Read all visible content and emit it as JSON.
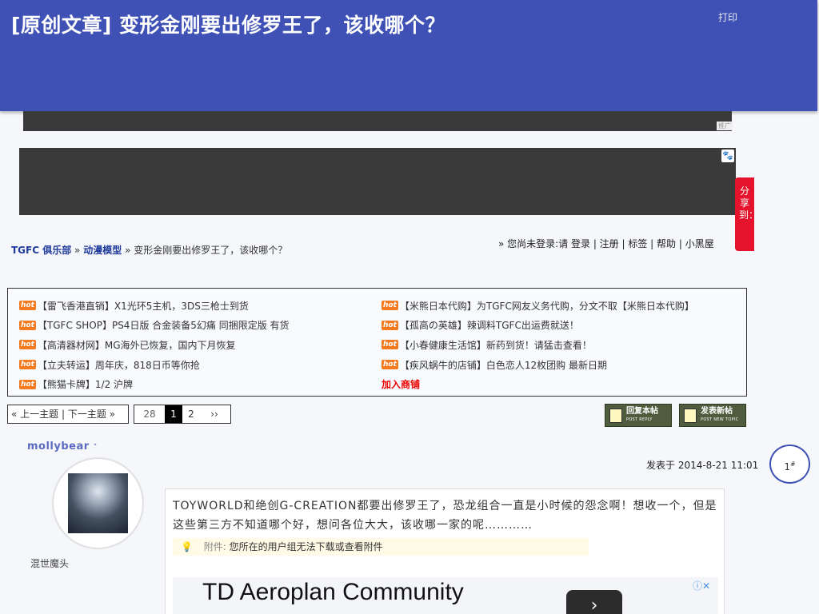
{
  "header": {
    "title": "[原创文章] 变形金刚要出修罗王了，该收哪个？",
    "print_label": "打印"
  },
  "ads": {
    "tag": "推广",
    "share_label": "分享到：",
    "bottom_ad_title": "TD Aeroplan Community",
    "bottom_ad_arrow": "›",
    "bottom_ad_info": "ⓘ✕"
  },
  "breadcrumb": {
    "site": "TGFC 俱乐部",
    "sep": "»",
    "forum": "动漫模型",
    "thread": "变形金刚要出修罗王了，该收哪个？"
  },
  "login_bar": "» 您尚未登录:请 登录 | 注册 | 标签 | 帮助 | 小黑屋",
  "hot_label": "hot",
  "sponsor_links": {
    "left": [
      "【雷飞香港直销】X1光环5主机，3DS三枪士到货",
      "【TGFC SHOP】PS4日版 合金装备5幻痛 同捆限定版 有货",
      "【高清器材网】MG海外已恢复，国内下月恢复",
      "【立夫转运】周年庆，818日币等你抢",
      "【熊猫卡牌】1/2 沪牌"
    ],
    "right": [
      "【米熊日本代购】为TGFC网友义务代购，分文不取【米熊日本代购】",
      "【孤高の英雄】辣调料TGFC出运费就送！",
      "【小春健康生活馆】新药到货！请猛击查看！",
      "【疾风蜗牛的店铺】白色恋人12枚团购 最新日期"
    ],
    "join_label": "加入商铺"
  },
  "pager": {
    "prev_next": "« 上一主题 | 下一主题 »",
    "pages": [
      "28",
      "1",
      "2",
      "››"
    ]
  },
  "buttons": {
    "reply_label": "回复本帖",
    "reply_sub": "POST REPLY",
    "new_label": "发表新帖",
    "new_sub": "POST NEW TOPIC"
  },
  "post": {
    "username": "mollybear",
    "user_title": "混世魔头",
    "posted_at": "发表于 2014-8-21 11:01",
    "floor": "1",
    "floor_mark": "#",
    "content": "TOYWORLD和绝创G-CREATION都要出修罗王了，恐龙组合一直是小时候的怨念啊！想收一个，但是这些第三方不知道哪个好，想问各位大大，该收哪一家的呢…………",
    "attach_label": "附件:",
    "attach_text": "您所在的用户组无法下载或查看附件"
  }
}
